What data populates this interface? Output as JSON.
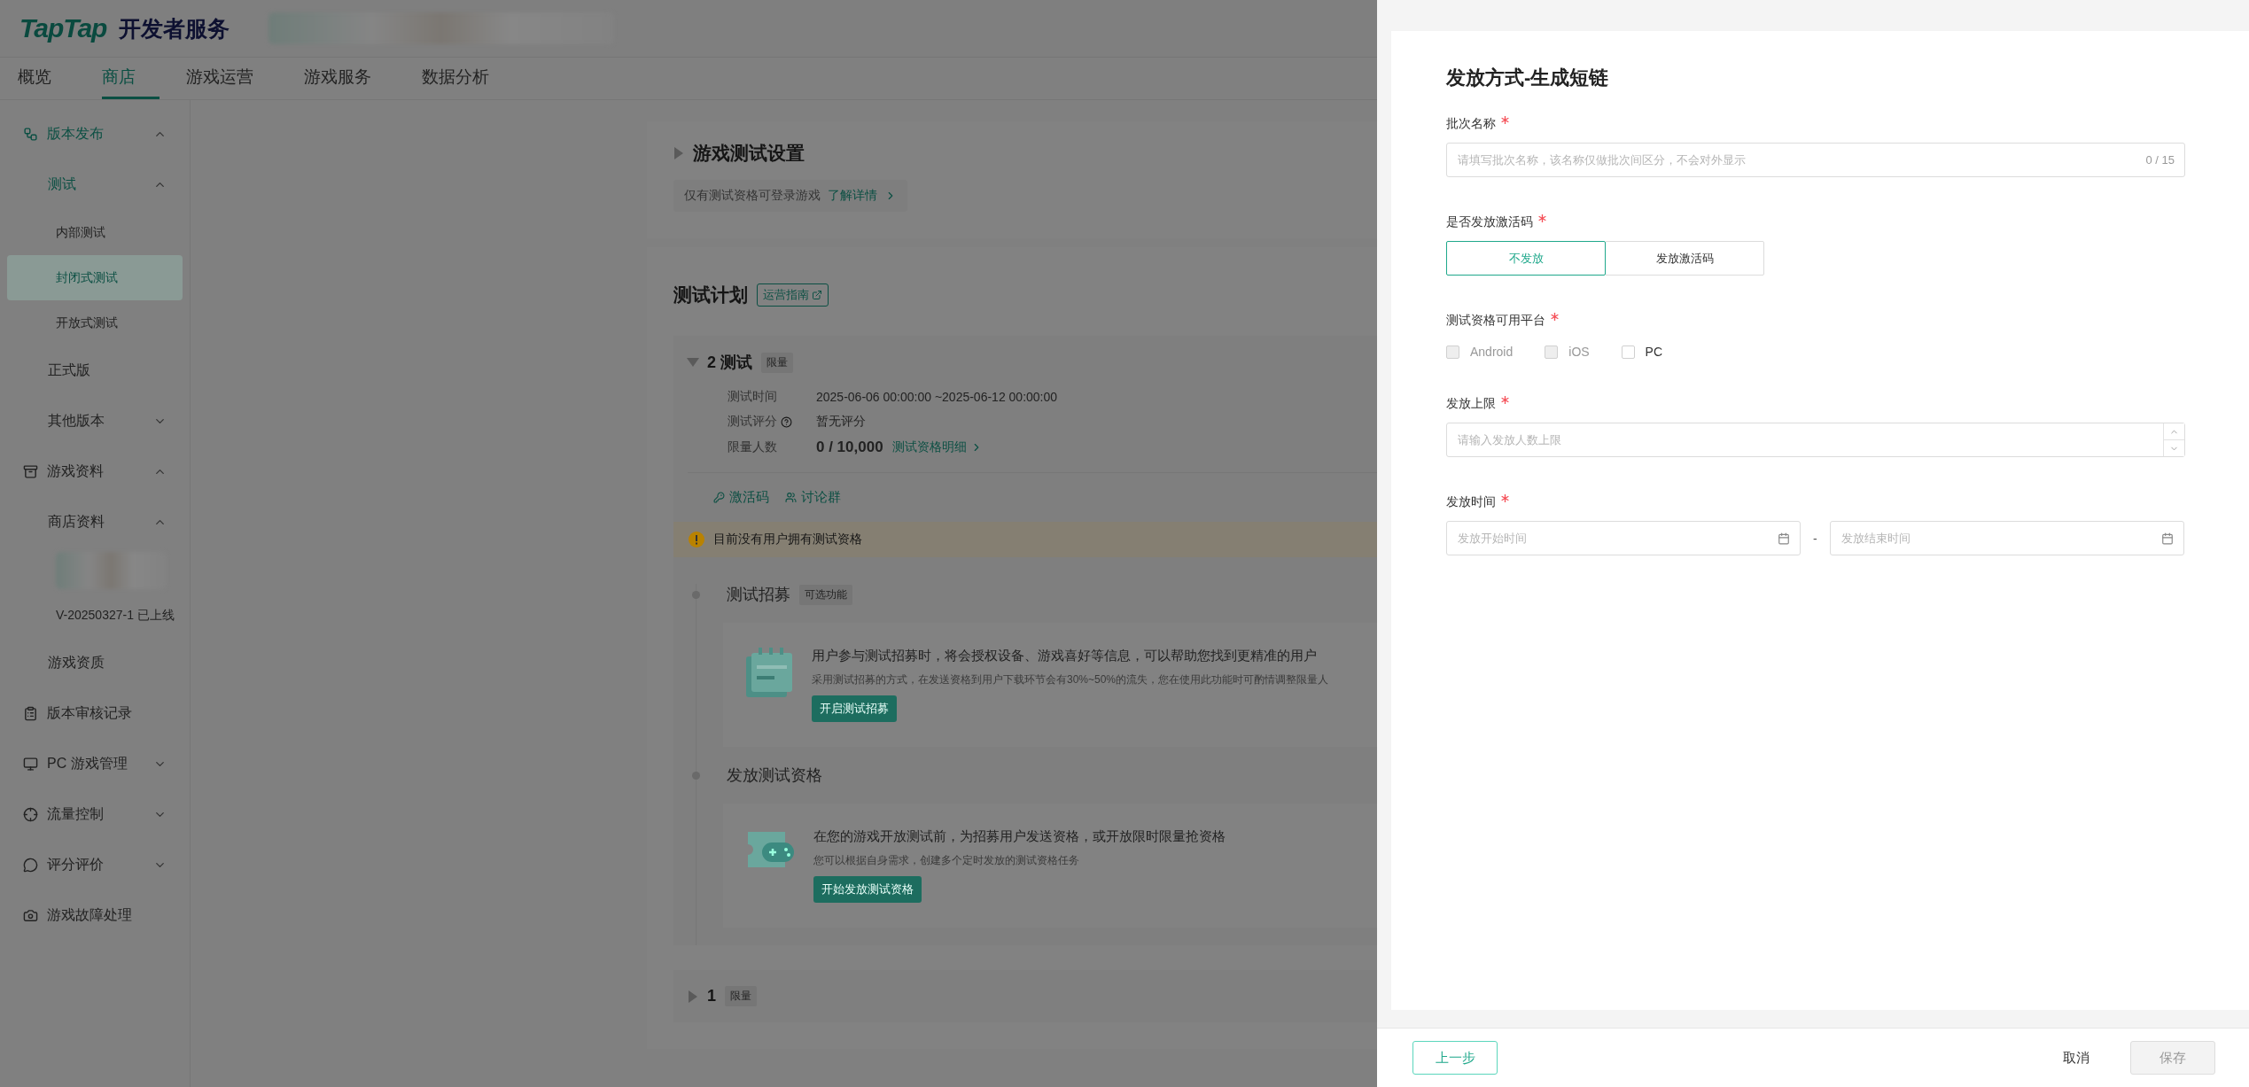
{
  "header": {
    "logo": "TapTap",
    "product": "开发者服务"
  },
  "nav": {
    "tabs": [
      {
        "label": "概览",
        "selected": false
      },
      {
        "label": "商店",
        "selected": true
      },
      {
        "label": "游戏运营",
        "selected": false
      },
      {
        "label": "游戏服务",
        "selected": false
      },
      {
        "label": "数据分析",
        "selected": false
      }
    ]
  },
  "sidebar": {
    "items": [
      {
        "label": "版本发布",
        "active": true,
        "expanded": true,
        "children": [
          {
            "label": "测试",
            "active": true,
            "expanded": true,
            "children": [
              {
                "label": "内部测试",
                "selected": false
              },
              {
                "label": "封闭式测试",
                "selected": true
              },
              {
                "label": "开放式测试",
                "selected": false
              }
            ]
          },
          {
            "label": "正式版",
            "active": false
          },
          {
            "label": "其他版本",
            "active": false,
            "expanded": false
          }
        ]
      },
      {
        "label": "游戏资料",
        "active": false,
        "expanded": true,
        "children": [
          {
            "label": "商店资料",
            "active": false,
            "expanded": true,
            "children": [
              {
                "kind": "redacted"
              },
              {
                "kind": "link",
                "label": "V-20250327-1 已上线",
                "selected": false
              }
            ]
          },
          {
            "label": "游戏资质",
            "active": false
          }
        ]
      },
      {
        "label": "版本审核记录",
        "active": false
      },
      {
        "label": "PC 游戏管理",
        "active": false,
        "expanded": false
      },
      {
        "label": "流量控制",
        "active": false,
        "expanded": false
      },
      {
        "label": "评分评价",
        "active": false,
        "expanded": false
      },
      {
        "label": "游戏故障处理",
        "active": false
      }
    ]
  },
  "settings": {
    "title": "游戏测试设置",
    "expanded": false,
    "note": "仅有测试资格可登录游戏",
    "link": "了解详情"
  },
  "plan": {
    "title": "测试计划",
    "guide": "运营指南",
    "batches": [
      {
        "name": "2 测试",
        "tag": "限量",
        "expanded": true,
        "fields": [
          {
            "label": "测试时间",
            "value": "2025-06-06 00:00:00 ~2025-06-12 00:00:00"
          },
          {
            "label": "测试评分",
            "value": "暂无评分",
            "help": true
          },
          {
            "label": "限量人数",
            "value": "0 / 10,000",
            "link": "测试资格明细"
          }
        ],
        "actions": [
          "激活码",
          "讨论群"
        ],
        "alert": "目前没有用户拥有测试资格",
        "steps": [
          {
            "title": "测试招募",
            "tag": "可选功能",
            "headline": "用户参与测试招募时，将会授权设备、游戏喜好等信息，可以帮助您找到更精准的用户",
            "desc": "采用测试招募的方式，在发送资格到用户下载环节会有30%~50%的流失，您在使用此功能时可酌情调整限量人",
            "button": "开启测试招募"
          },
          {
            "title": "发放测试资格",
            "headline": "在您的游戏开放测试前，为招募用户发送资格，或开放限时限量抢资格",
            "desc": "您可以根据自身需求，创建多个定时发放的测试资格任务",
            "button": "开始发放测试资格"
          }
        ]
      },
      {
        "name": "1",
        "tag": "限量",
        "expanded": false
      }
    ]
  },
  "drawer": {
    "title": "发放方式-生成短链",
    "fields": [
      {
        "kind": "text",
        "label": "批次名称",
        "required": true,
        "placeholder": "请填写批次名称，该名称仅做批次间区分，不会对外显示",
        "counter": "0 / 15"
      },
      {
        "kind": "segmented",
        "label": "是否发放激活码",
        "required": true,
        "options": [
          {
            "label": "不发放",
            "selected": true
          },
          {
            "label": "发放激活码",
            "selected": false
          }
        ]
      },
      {
        "kind": "checkboxes",
        "label": "测试资格可用平台",
        "required": true,
        "options": [
          {
            "label": "Android",
            "checked": false,
            "disabled": true
          },
          {
            "label": "iOS",
            "checked": false,
            "disabled": true
          },
          {
            "label": "PC",
            "checked": false,
            "disabled": false
          }
        ]
      },
      {
        "kind": "number",
        "label": "发放上限",
        "required": true,
        "placeholder": "请输入发放人数上限"
      },
      {
        "kind": "daterange",
        "label": "发放时间",
        "required": true,
        "start_placeholder": "发放开始时间",
        "separator": "-",
        "end_placeholder": "发放结束时间"
      }
    ],
    "footer": {
      "back": "上一步",
      "cancel": "取消",
      "save": {
        "label": "保存",
        "disabled": true
      }
    }
  }
}
